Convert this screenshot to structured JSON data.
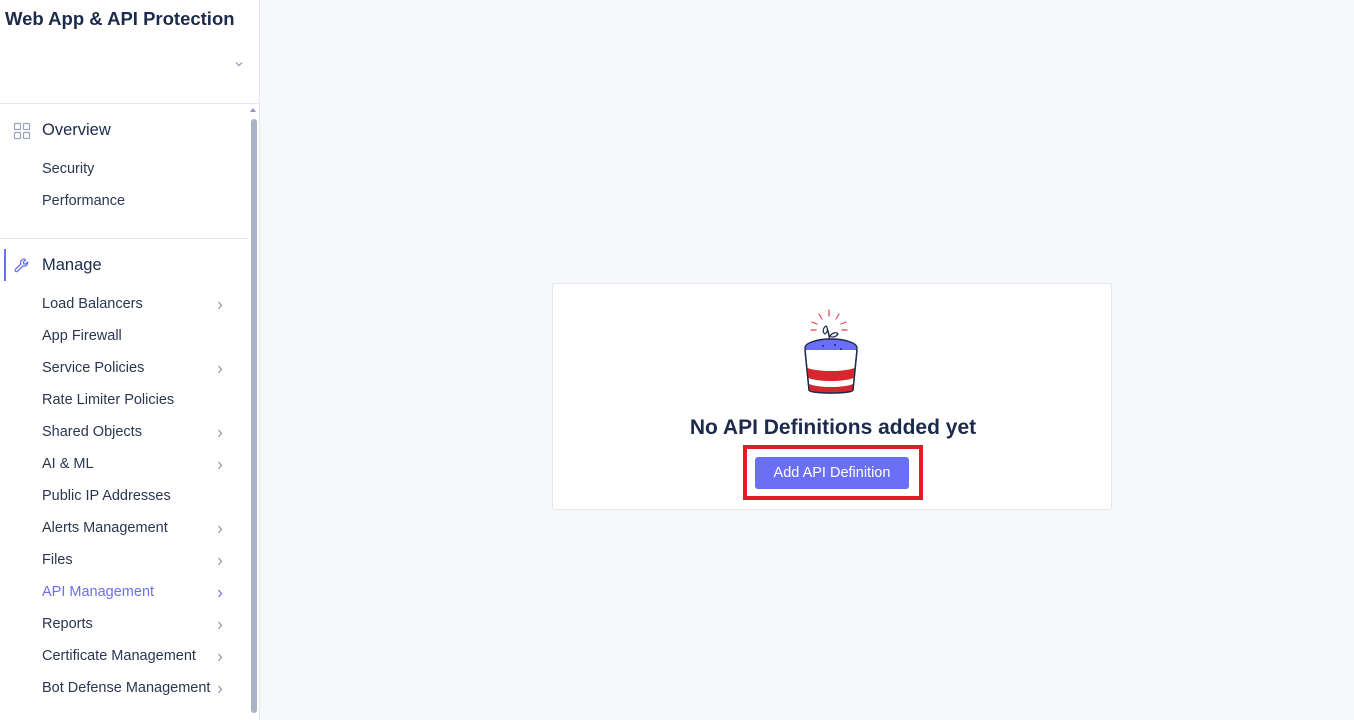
{
  "app": {
    "title": "Web App & API Protection"
  },
  "sidebar": {
    "overview": {
      "label": "Overview",
      "items": [
        {
          "label": "Security"
        },
        {
          "label": "Performance"
        }
      ]
    },
    "manage": {
      "label": "Manage",
      "items": [
        {
          "label": "Load Balancers",
          "has_submenu": true
        },
        {
          "label": "App Firewall",
          "has_submenu": false
        },
        {
          "label": "Service Policies",
          "has_submenu": true
        },
        {
          "label": "Rate Limiter Policies",
          "has_submenu": false
        },
        {
          "label": "Shared Objects",
          "has_submenu": true
        },
        {
          "label": "AI & ML",
          "has_submenu": true
        },
        {
          "label": "Public IP Addresses",
          "has_submenu": false
        },
        {
          "label": "Alerts Management",
          "has_submenu": true
        },
        {
          "label": "Files",
          "has_submenu": true
        },
        {
          "label": "API Management",
          "has_submenu": true,
          "selected": true
        },
        {
          "label": "Reports",
          "has_submenu": true
        },
        {
          "label": "Certificate Management",
          "has_submenu": true
        },
        {
          "label": "Bot Defense Management",
          "has_submenu": true
        }
      ]
    }
  },
  "main": {
    "empty_state": {
      "title": "No API Definitions added yet",
      "button_label": "Add API Definition",
      "illustration": "potted-plant-icon"
    }
  },
  "colors": {
    "accent": "#6b6ff5",
    "highlight": "#e21b25",
    "text": "#1c2b4b",
    "background": "#f7f8fa"
  }
}
